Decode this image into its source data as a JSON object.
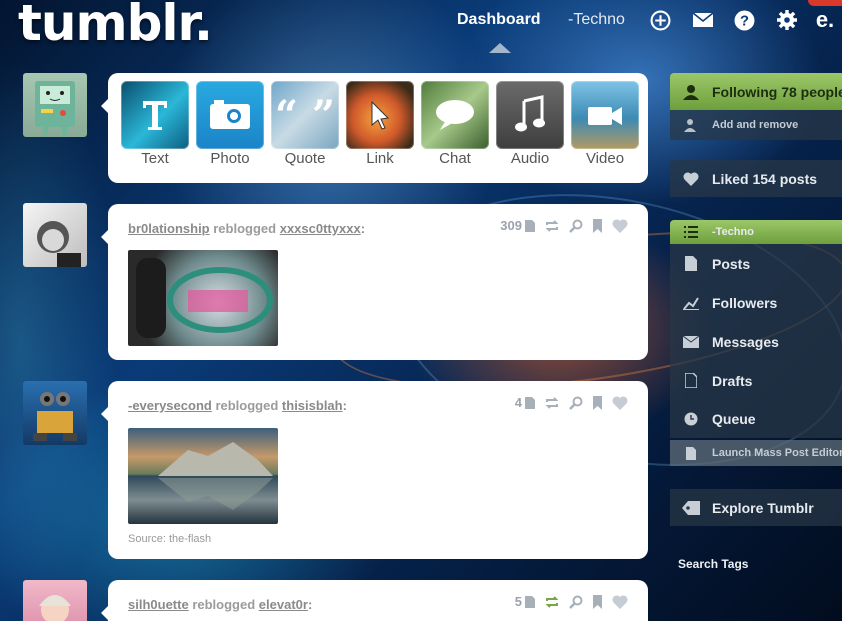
{
  "header": {
    "logo": "tumblr.",
    "nav_dashboard": "Dashboard",
    "nav_blog": "-Techno",
    "icons": [
      "plus-circle-icon",
      "mail-icon",
      "help-icon",
      "gear-icon",
      "account-icon"
    ]
  },
  "post_types": [
    {
      "label": "Text",
      "icon": "text-icon"
    },
    {
      "label": "Photo",
      "icon": "camera-icon"
    },
    {
      "label": "Quote",
      "icon": "quote-icon"
    },
    {
      "label": "Link",
      "icon": "link-cursor-icon"
    },
    {
      "label": "Chat",
      "icon": "chat-bubble-icon"
    },
    {
      "label": "Audio",
      "icon": "music-note-icon"
    },
    {
      "label": "Video",
      "icon": "video-icon"
    }
  ],
  "posts": [
    {
      "user": "br0lationship",
      "action": "reblogged",
      "source_user": "xxxsc0ttyxxx",
      "notes": "309"
    },
    {
      "user": "-everysecond",
      "action": "reblogged",
      "source_user": "thisisblah",
      "notes": "4",
      "caption": "Source: the-flash"
    },
    {
      "user": "silh0uette",
      "action": "reblogged",
      "source_user": "elevat0r",
      "notes": "5"
    }
  ],
  "sidebar": {
    "following": "Following 78 people",
    "add_remove": "Add and remove",
    "liked": "Liked 154 posts",
    "blog_name": "-Techno",
    "items": [
      {
        "label": "Posts",
        "icon": "document-icon"
      },
      {
        "label": "Followers",
        "icon": "chart-icon"
      },
      {
        "label": "Messages",
        "icon": "envelope-icon"
      },
      {
        "label": "Drafts",
        "icon": "draft-icon"
      },
      {
        "label": "Queue",
        "icon": "clock-icon"
      }
    ],
    "mass_editor": "Launch Mass Post Editor",
    "explore": "Explore Tumblr",
    "search_tags": "Search Tags"
  },
  "colors": {
    "accent_green": "#8fbf5a",
    "card_bg": "#ffffff",
    "sidebar_bg": "#28374a"
  }
}
